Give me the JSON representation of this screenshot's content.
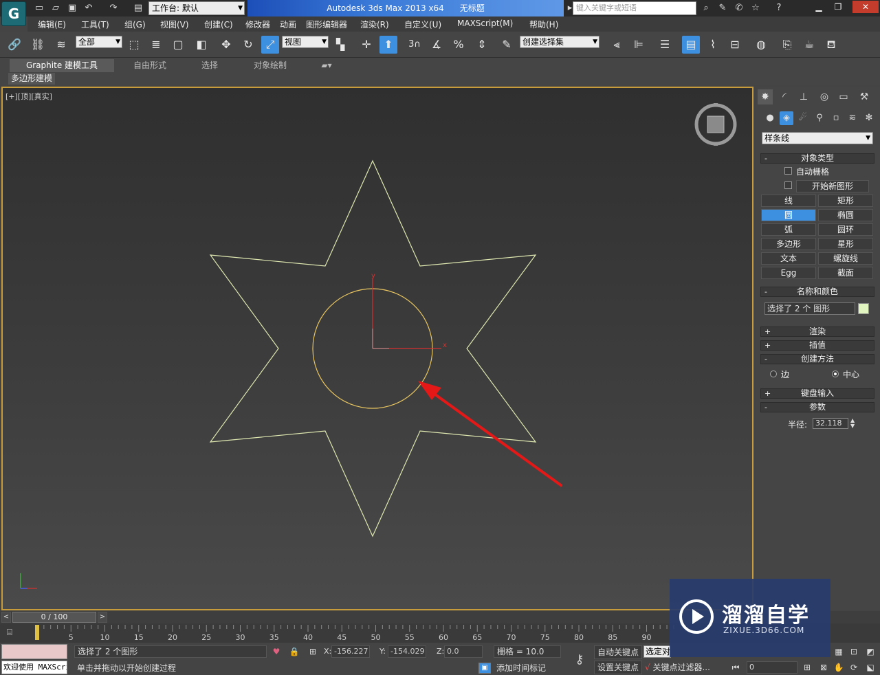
{
  "titlebar": {
    "logo": "G",
    "workspace": "工作台: 默认",
    "app_title": "Autodesk 3ds Max  2013 x64",
    "doc_title": "无标题",
    "search_placeholder": "键入关键字或短语"
  },
  "menu": [
    "编辑(E)",
    "工具(T)",
    "组(G)",
    "视图(V)",
    "创建(C)",
    "修改器",
    "动画",
    "图形编辑器",
    "渲染(R)",
    "自定义(U)",
    "MAXScript(M)",
    "帮助(H)"
  ],
  "toolbar": {
    "selection_filter": "全部",
    "ref_coord": "视图",
    "named_selection": "创建选择集",
    "snap_angle_label": "3"
  },
  "ribbon": {
    "tabs": [
      "Graphite 建模工具",
      "自由形式",
      "选择",
      "对象绘制"
    ],
    "sub_tab": "多边形建模"
  },
  "viewport": {
    "label": "[+][顶][真实]",
    "axis_y": "y",
    "axis_x": "x",
    "star_color": "#dfe8b0",
    "circle_color": "#e8c560",
    "arrow_color": "#e51818"
  },
  "command_panel": {
    "category": "样条线",
    "rollout_object_type": "对象类型",
    "auto_grid": "自动栅格",
    "start_new_shape": "开始新图形",
    "object_buttons": [
      "线",
      "矩形",
      "圆",
      "椭圆",
      "弧",
      "圆环",
      "多边形",
      "星形",
      "文本",
      "螺旋线",
      "Egg",
      "截面"
    ],
    "selected_button": "圆",
    "rollout_name_color": "名称和颜色",
    "name_value": "选择了 2 个 图形",
    "rollout_render": "渲染",
    "rollout_interp": "插值",
    "rollout_creation": "创建方法",
    "radio_edge": "边",
    "radio_center": "中心",
    "rollout_keyboard": "键盘输入",
    "rollout_params": "参数",
    "radius_label": "半径:",
    "radius_value": "32.118"
  },
  "timeline": {
    "position": "0 / 100",
    "ticks": [
      "0",
      "5",
      "10",
      "15",
      "20",
      "25",
      "30",
      "35",
      "40",
      "45",
      "50",
      "55",
      "60",
      "65",
      "70",
      "75",
      "80",
      "85",
      "90"
    ]
  },
  "status": {
    "welcome": "欢迎使用 MAXScri",
    "selection": "选择了 2 个图形",
    "prompt": "单击并拖动以开始创建过程",
    "x_label": "X:",
    "x_value": "-156.227",
    "y_label": "Y:",
    "y_value": "-154.029",
    "z_label": "Z:",
    "z_value": "0.0",
    "grid": "栅格 = 10.0",
    "add_time_tag": "添加时间标记",
    "auto_key": "自动关键点",
    "set_key": "设置关键点",
    "selected_dd": "选定对",
    "key_filter": "关键点过滤器...",
    "frame": "0"
  },
  "watermark": {
    "title": "溜溜自学",
    "url": "ZIXUE.3D66.COM"
  }
}
